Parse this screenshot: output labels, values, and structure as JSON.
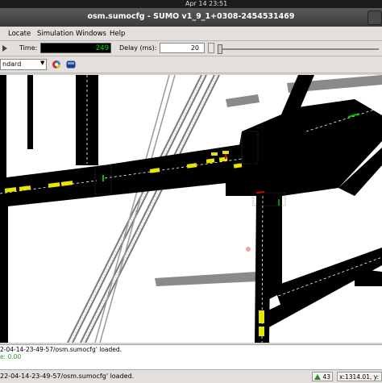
{
  "system": {
    "clock": "Apr 14  23:51"
  },
  "window": {
    "title": "osm.sumocfg - SUMO v1_9_1+0308-2454531469"
  },
  "menu": [
    "Locate",
    "Simulation",
    "Windows",
    "Help"
  ],
  "toolbar": {
    "time_label": "Time:",
    "time_value": "249",
    "delay_label": "Delay (ms):",
    "delay_value": "20"
  },
  "view_toolbar": {
    "scheme": "ndard"
  },
  "messages": {
    "line1": "2-04-14-23-49-57/osm.sumocfg' loaded.",
    "line2": "e: 0.00"
  },
  "status": {
    "text": "22-04-14-23-49-57/osm.sumocfg' loaded.",
    "vehicle_count": "43",
    "coords": "x:1314.01, y:"
  },
  "colors": {
    "road": "#000000",
    "rail": "#8a8a8a",
    "vehicle": "#e6e600",
    "signal_green": "#00c000",
    "signal_red": "#d00000"
  }
}
